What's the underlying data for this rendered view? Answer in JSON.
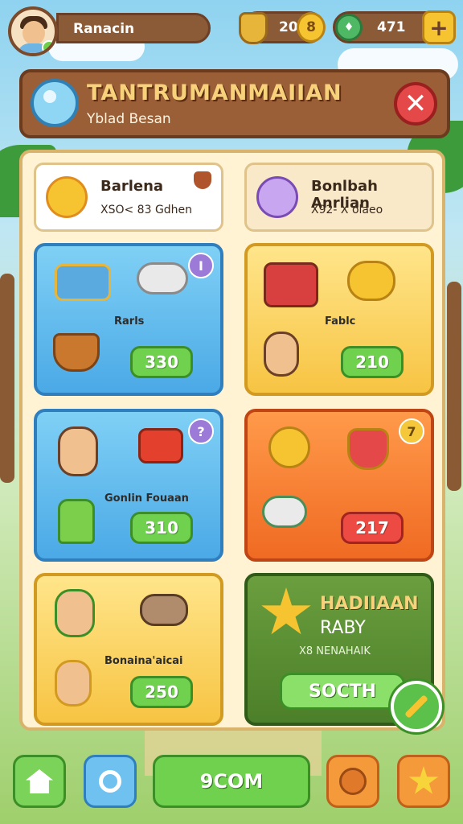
{
  "player": {
    "name": "Ranacin"
  },
  "currency": {
    "gold": "20",
    "coin_badge": "8",
    "gems": "471",
    "plus": "+"
  },
  "header": {
    "title": "TANTRUMANMAIIAN",
    "subtitle": "Yblad Besan",
    "close": "✕"
  },
  "profiles": [
    {
      "name": "Barlena",
      "detail": "XSO< 83 Gdhen"
    },
    {
      "name": "Bonlbah Anrlian",
      "detail": "X92- X olaeo"
    }
  ],
  "tiles": [
    {
      "label": "Rarls",
      "price": "330",
      "corner": "I"
    },
    {
      "label": "Fablc",
      "price": "210"
    },
    {
      "label": "Gonlin Fouaan",
      "price": "310",
      "corner": "?"
    },
    {
      "price": "217",
      "corner": "7"
    },
    {
      "label": "Bonaina'aicai",
      "price": "250"
    }
  ],
  "reward": {
    "title": "HADIIAAN",
    "subtitle": "RABY",
    "note": "X8 NENAHAIK",
    "button": "SOCTH"
  },
  "bottom_bar": {
    "primary": "9COM"
  }
}
